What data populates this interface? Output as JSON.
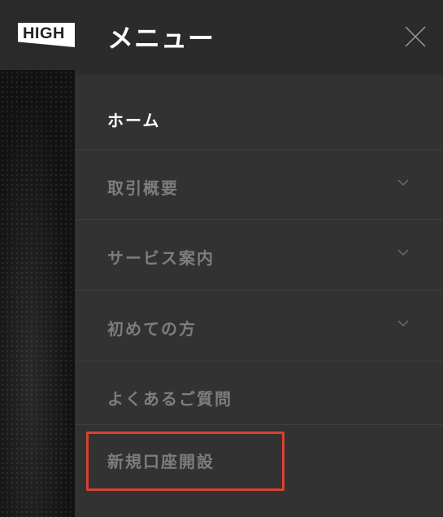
{
  "brand": {
    "logo_text": "HIGH"
  },
  "menu": {
    "title": "メニュー",
    "close_icon": "close-icon",
    "items": [
      {
        "label": "ホーム",
        "active": true,
        "expandable": false
      },
      {
        "label": "取引概要",
        "active": false,
        "expandable": true
      },
      {
        "label": "サービス案内",
        "active": false,
        "expandable": true
      },
      {
        "label": "初めての方",
        "active": false,
        "expandable": true
      },
      {
        "label": "よくあるご質問",
        "active": false,
        "expandable": false
      },
      {
        "label": "新規口座開設",
        "active": false,
        "expandable": false,
        "highlighted": true
      }
    ]
  },
  "colors": {
    "drawer_bg": "#323232",
    "header_bg": "#2b2b2b",
    "active_text": "#ffffff",
    "inactive_text": "#7d7d7d",
    "highlight": "#d9412f"
  }
}
